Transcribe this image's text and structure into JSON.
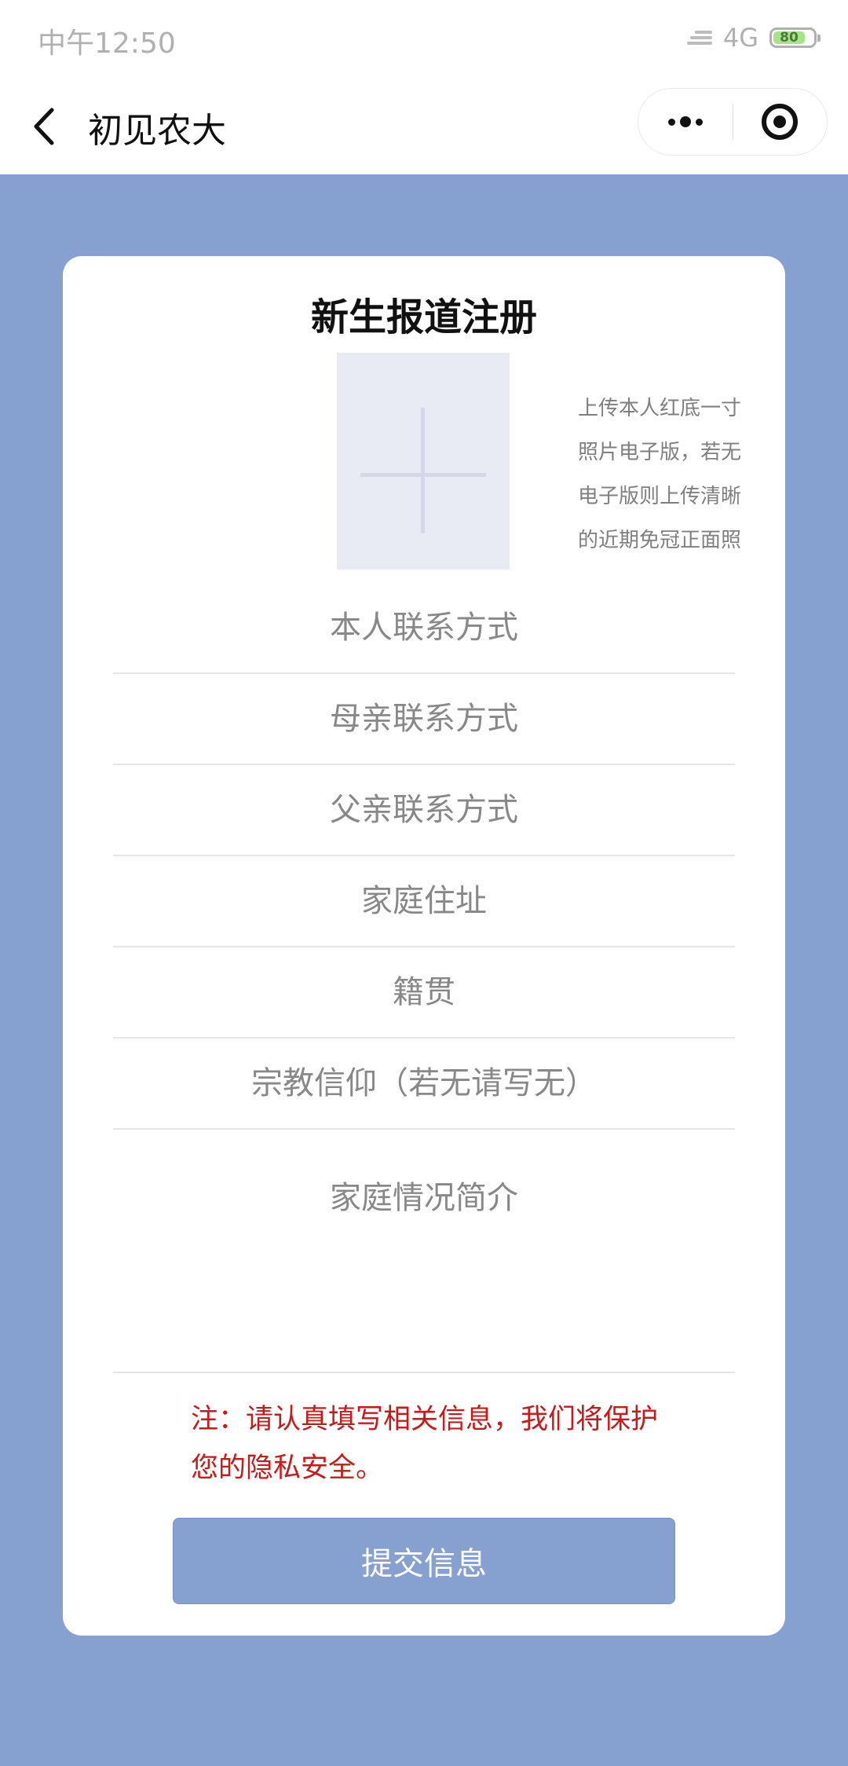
{
  "status_bar": {
    "time": "中午12:50",
    "network": "4G",
    "battery": "80",
    "battery_level": 0.8
  },
  "nav": {
    "title": "初见农大",
    "back_icon": "chevron-left-icon",
    "menu_icon": "more-dots-icon",
    "close_icon": "target-icon"
  },
  "colors": {
    "page_background": "#86a0d0",
    "submit_button": "#86a0d0",
    "notice_text": "#c61b1b",
    "card": "#ffffff"
  },
  "form": {
    "title": "新生报道注册",
    "photo": {
      "icon": "plus-icon",
      "hint_lines": [
        "上传本人红底一寸",
        "照片电子版，若无",
        "电子版则上传清晰",
        "的近期免冠正面照"
      ]
    },
    "fields": [
      {
        "placeholder": "本人联系方式"
      },
      {
        "placeholder": "母亲联系方式"
      },
      {
        "placeholder": "父亲联系方式"
      },
      {
        "placeholder": "家庭住址"
      },
      {
        "placeholder": "籍贯"
      },
      {
        "placeholder": "宗教信仰（若无请写无）"
      }
    ],
    "family_intro": {
      "placeholder": "家庭情况简介"
    },
    "notice_lines": [
      "注：请认真填写相关信息，我们将保护",
      "您的隐私安全。"
    ],
    "submit_label": "提交信息"
  }
}
